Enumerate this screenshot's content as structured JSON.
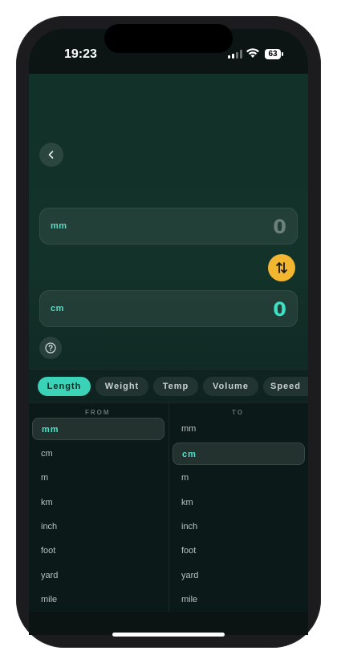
{
  "status_bar": {
    "time": "19:23",
    "battery": "63"
  },
  "converter": {
    "from_unit": "mm",
    "from_value": "0",
    "to_unit": "cm",
    "to_value": "0"
  },
  "categories": [
    {
      "label": "Length",
      "active": true
    },
    {
      "label": "Weight",
      "active": false
    },
    {
      "label": "Temp",
      "active": false
    },
    {
      "label": "Volume",
      "active": false
    },
    {
      "label": "Speed",
      "active": false
    }
  ],
  "lists": {
    "from_header": "FROM",
    "to_header": "TO",
    "from_items": [
      "mm",
      "cm",
      "m",
      "km",
      "inch",
      "foot",
      "yard",
      "mile"
    ],
    "to_items": [
      "mm",
      "cm",
      "m",
      "km",
      "inch",
      "foot",
      "yard",
      "mile"
    ],
    "from_selected": "mm",
    "to_selected": "cm"
  },
  "colors": {
    "accent": "#3bd3b8",
    "swap_button": "#f2b630",
    "background": "#133229"
  }
}
